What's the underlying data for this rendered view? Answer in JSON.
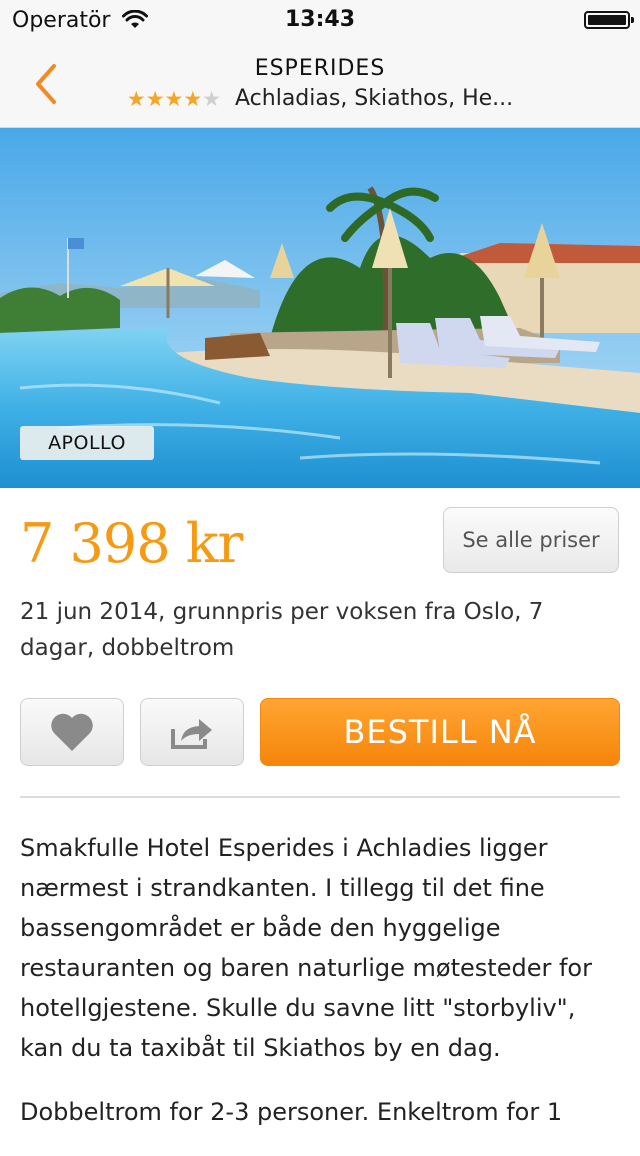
{
  "status_bar": {
    "carrier": "Operatör",
    "time": "13:43"
  },
  "nav": {
    "title": "ESPERIDES",
    "rating": 4,
    "rating_max": 5,
    "location": "Achladias, Skiathos, He...",
    "accent_color": "#f08a24",
    "star_color": "#f5a623"
  },
  "hero": {
    "badge": "APOLLO"
  },
  "offer": {
    "price": "7 398  kr",
    "see_all_prices": "Se alle priser",
    "details": "21 jun 2014, grunnpris per voksen fra Oslo, 7 dagar, dobbeltrom",
    "price_color": "#f59a12"
  },
  "actions": {
    "book_label": "BESTILL NÅ",
    "book_color": "#f7931e",
    "favorite_icon": "heart-icon",
    "share_icon": "share-icon"
  },
  "description": {
    "paragraphs": [
      "Smakfulle Hotel Esperides i Achladies ligger nærmest i strandkanten. I tillegg til det fine bassengområdet er både den hyggelige restauranten og baren naturlige møtesteder for hotellgjestene. Skulle du savne litt \"storbyliv\", kan du ta taxibåt til Skiathos by en dag.",
      "Dobbeltrom for 2-3 personer. Enkeltrom for 1"
    ]
  }
}
